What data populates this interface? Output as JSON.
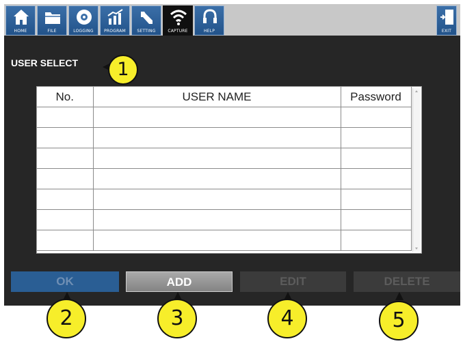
{
  "nav": {
    "items": [
      {
        "label": "HOME",
        "icon": "home-icon"
      },
      {
        "label": "FILE",
        "icon": "folder-icon"
      },
      {
        "label": "LOGGING",
        "icon": "disc-icon"
      },
      {
        "label": "PROGRAM",
        "icon": "chart-icon"
      },
      {
        "label": "SETTING",
        "icon": "wrench-icon"
      },
      {
        "label": "CAPTURE",
        "icon": "wifi-icon",
        "active": true
      },
      {
        "label": "HELP",
        "icon": "headset-icon"
      }
    ],
    "exit": {
      "label": "EXIT",
      "icon": "exit-door-icon"
    }
  },
  "section": {
    "title": "USER SELECT"
  },
  "table": {
    "headers": [
      "No.",
      "USER NAME",
      "Password"
    ],
    "rows": [
      [
        "",
        "",
        ""
      ],
      [
        "",
        "",
        ""
      ],
      [
        "",
        "",
        ""
      ],
      [
        "",
        "",
        ""
      ],
      [
        "",
        "",
        ""
      ],
      [
        "",
        "",
        ""
      ],
      [
        "",
        "",
        ""
      ]
    ]
  },
  "buttons": {
    "ok": "OK",
    "add": "ADD",
    "edit": "EDIT",
    "delete": "DELETE"
  },
  "callouts": [
    "1",
    "2",
    "3",
    "4",
    "5"
  ],
  "colors": {
    "callout_fill": "#f7ee2a",
    "nav_button": "#2a5e94",
    "active_nav": "#101010",
    "screen_bg": "#262626"
  }
}
